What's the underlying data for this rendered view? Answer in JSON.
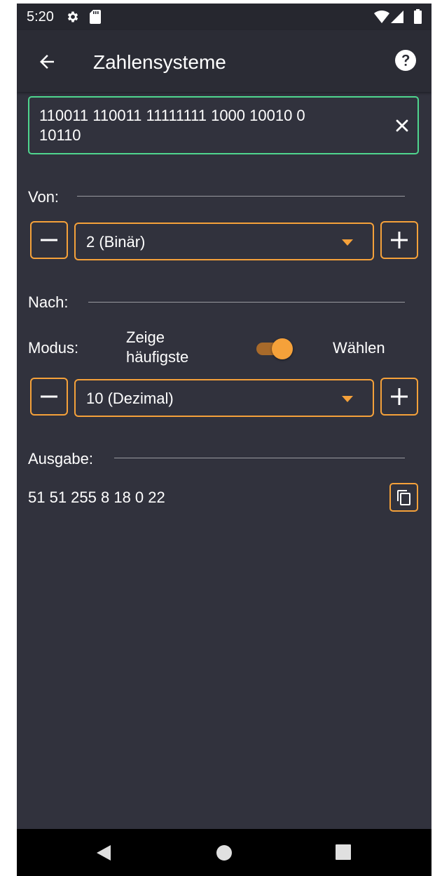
{
  "status_bar": {
    "time": "5:20",
    "icons": [
      "settings-icon",
      "sd-card-icon",
      "wifi-icon",
      "signal-icon",
      "battery-icon"
    ]
  },
  "app_bar": {
    "title": "Zahlensysteme",
    "icons": [
      "back-arrow-icon",
      "help-icon"
    ]
  },
  "input": {
    "value": "110011 110011 11111111 1000 10010 0\n10110",
    "clear_icon": "close-icon"
  },
  "from": {
    "label": "Von:",
    "selected": "2 (Binär)",
    "minus_icon": "minus-icon",
    "plus_icon": "plus-icon"
  },
  "to": {
    "label": "Nach:",
    "mode_label": "Modus:",
    "mode_option_left": "Zeige\nhäufigste",
    "mode_option_right": "Wählen",
    "mode_toggle_on": true,
    "selected": "10 (Dezimal)"
  },
  "output": {
    "label": "Ausgabe:",
    "value": "51 51 255 8 18 0 22",
    "copy_icon": "copy-icon"
  },
  "nav_bar": {
    "icons": [
      "back-triangle-icon",
      "home-circle-icon",
      "recents-square-icon"
    ]
  },
  "colors": {
    "background": "#31323d",
    "app_bar": "#2b2c35",
    "accent": "#f5a13a",
    "focus": "#4fd58e"
  }
}
